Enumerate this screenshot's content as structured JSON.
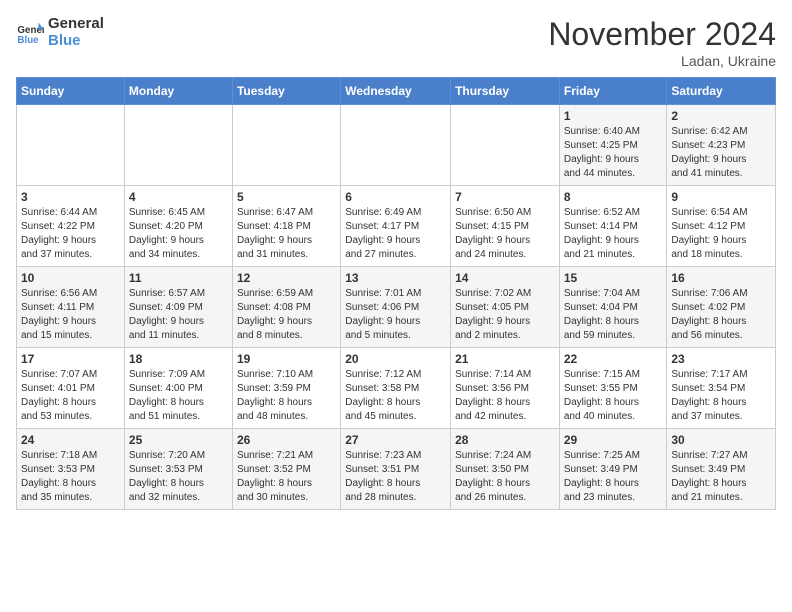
{
  "logo": {
    "line1": "General",
    "line2": "Blue"
  },
  "title": "November 2024",
  "location": "Ladan, Ukraine",
  "days_of_week": [
    "Sunday",
    "Monday",
    "Tuesday",
    "Wednesday",
    "Thursday",
    "Friday",
    "Saturday"
  ],
  "weeks": [
    [
      {
        "num": "",
        "info": ""
      },
      {
        "num": "",
        "info": ""
      },
      {
        "num": "",
        "info": ""
      },
      {
        "num": "",
        "info": ""
      },
      {
        "num": "",
        "info": ""
      },
      {
        "num": "1",
        "info": "Sunrise: 6:40 AM\nSunset: 4:25 PM\nDaylight: 9 hours\nand 44 minutes."
      },
      {
        "num": "2",
        "info": "Sunrise: 6:42 AM\nSunset: 4:23 PM\nDaylight: 9 hours\nand 41 minutes."
      }
    ],
    [
      {
        "num": "3",
        "info": "Sunrise: 6:44 AM\nSunset: 4:22 PM\nDaylight: 9 hours\nand 37 minutes."
      },
      {
        "num": "4",
        "info": "Sunrise: 6:45 AM\nSunset: 4:20 PM\nDaylight: 9 hours\nand 34 minutes."
      },
      {
        "num": "5",
        "info": "Sunrise: 6:47 AM\nSunset: 4:18 PM\nDaylight: 9 hours\nand 31 minutes."
      },
      {
        "num": "6",
        "info": "Sunrise: 6:49 AM\nSunset: 4:17 PM\nDaylight: 9 hours\nand 27 minutes."
      },
      {
        "num": "7",
        "info": "Sunrise: 6:50 AM\nSunset: 4:15 PM\nDaylight: 9 hours\nand 24 minutes."
      },
      {
        "num": "8",
        "info": "Sunrise: 6:52 AM\nSunset: 4:14 PM\nDaylight: 9 hours\nand 21 minutes."
      },
      {
        "num": "9",
        "info": "Sunrise: 6:54 AM\nSunset: 4:12 PM\nDaylight: 9 hours\nand 18 minutes."
      }
    ],
    [
      {
        "num": "10",
        "info": "Sunrise: 6:56 AM\nSunset: 4:11 PM\nDaylight: 9 hours\nand 15 minutes."
      },
      {
        "num": "11",
        "info": "Sunrise: 6:57 AM\nSunset: 4:09 PM\nDaylight: 9 hours\nand 11 minutes."
      },
      {
        "num": "12",
        "info": "Sunrise: 6:59 AM\nSunset: 4:08 PM\nDaylight: 9 hours\nand 8 minutes."
      },
      {
        "num": "13",
        "info": "Sunrise: 7:01 AM\nSunset: 4:06 PM\nDaylight: 9 hours\nand 5 minutes."
      },
      {
        "num": "14",
        "info": "Sunrise: 7:02 AM\nSunset: 4:05 PM\nDaylight: 9 hours\nand 2 minutes."
      },
      {
        "num": "15",
        "info": "Sunrise: 7:04 AM\nSunset: 4:04 PM\nDaylight: 8 hours\nand 59 minutes."
      },
      {
        "num": "16",
        "info": "Sunrise: 7:06 AM\nSunset: 4:02 PM\nDaylight: 8 hours\nand 56 minutes."
      }
    ],
    [
      {
        "num": "17",
        "info": "Sunrise: 7:07 AM\nSunset: 4:01 PM\nDaylight: 8 hours\nand 53 minutes."
      },
      {
        "num": "18",
        "info": "Sunrise: 7:09 AM\nSunset: 4:00 PM\nDaylight: 8 hours\nand 51 minutes."
      },
      {
        "num": "19",
        "info": "Sunrise: 7:10 AM\nSunset: 3:59 PM\nDaylight: 8 hours\nand 48 minutes."
      },
      {
        "num": "20",
        "info": "Sunrise: 7:12 AM\nSunset: 3:58 PM\nDaylight: 8 hours\nand 45 minutes."
      },
      {
        "num": "21",
        "info": "Sunrise: 7:14 AM\nSunset: 3:56 PM\nDaylight: 8 hours\nand 42 minutes."
      },
      {
        "num": "22",
        "info": "Sunrise: 7:15 AM\nSunset: 3:55 PM\nDaylight: 8 hours\nand 40 minutes."
      },
      {
        "num": "23",
        "info": "Sunrise: 7:17 AM\nSunset: 3:54 PM\nDaylight: 8 hours\nand 37 minutes."
      }
    ],
    [
      {
        "num": "24",
        "info": "Sunrise: 7:18 AM\nSunset: 3:53 PM\nDaylight: 8 hours\nand 35 minutes."
      },
      {
        "num": "25",
        "info": "Sunrise: 7:20 AM\nSunset: 3:53 PM\nDaylight: 8 hours\nand 32 minutes."
      },
      {
        "num": "26",
        "info": "Sunrise: 7:21 AM\nSunset: 3:52 PM\nDaylight: 8 hours\nand 30 minutes."
      },
      {
        "num": "27",
        "info": "Sunrise: 7:23 AM\nSunset: 3:51 PM\nDaylight: 8 hours\nand 28 minutes."
      },
      {
        "num": "28",
        "info": "Sunrise: 7:24 AM\nSunset: 3:50 PM\nDaylight: 8 hours\nand 26 minutes."
      },
      {
        "num": "29",
        "info": "Sunrise: 7:25 AM\nSunset: 3:49 PM\nDaylight: 8 hours\nand 23 minutes."
      },
      {
        "num": "30",
        "info": "Sunrise: 7:27 AM\nSunset: 3:49 PM\nDaylight: 8 hours\nand 21 minutes."
      }
    ]
  ]
}
